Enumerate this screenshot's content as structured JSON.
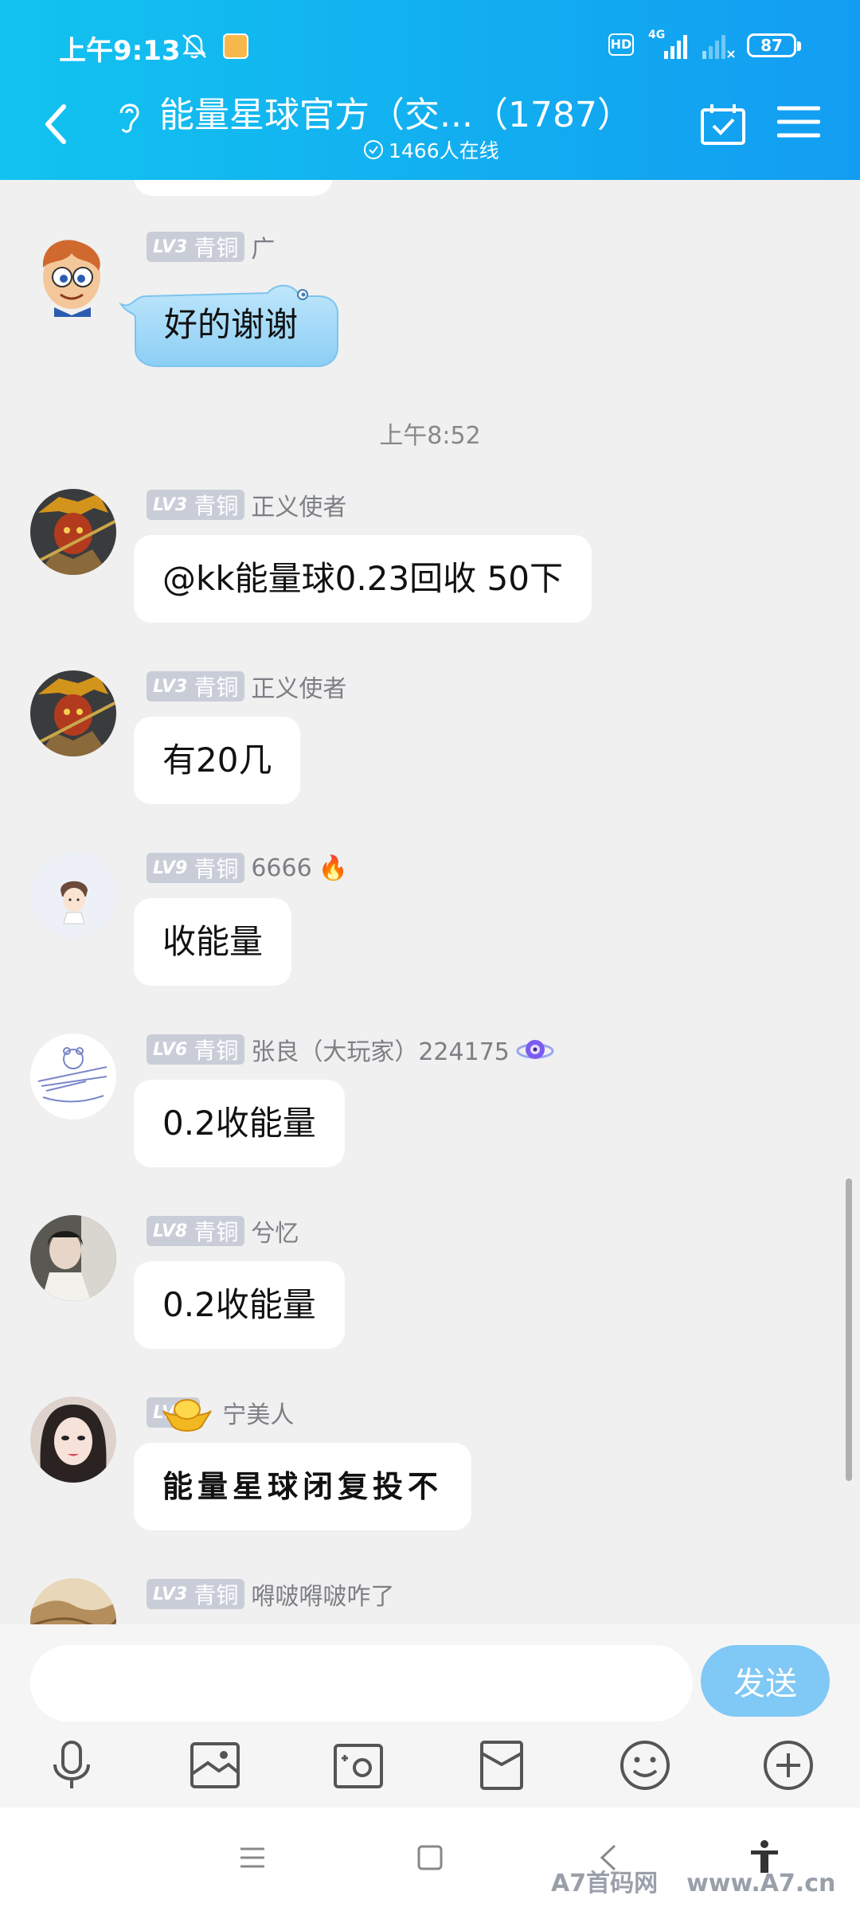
{
  "status_bar": {
    "time": "上午9:13",
    "network_type": "HD",
    "network_gen": "4G",
    "battery": "87"
  },
  "header": {
    "title": "能量星球官方（交...（1787）",
    "online": "1466人在线"
  },
  "messages": [
    {
      "level": "LV3",
      "rank": "青铜",
      "nick": "广",
      "text": "好的谢谢",
      "style": "cloud"
    },
    {
      "timestamp": "上午8:52"
    },
    {
      "level": "LV3",
      "rank": "青铜",
      "nick": "正义使者",
      "text": "@kk能量球0.23回收 50下"
    },
    {
      "level": "LV3",
      "rank": "青铜",
      "nick": "正义使者",
      "text": "有20几"
    },
    {
      "level": "LV9",
      "rank": "青铜",
      "nick": "6666",
      "badge": "🔥",
      "text": "收能量"
    },
    {
      "level": "LV6",
      "rank": "青铜",
      "nick": "张良（大玩家）224175",
      "badge": "planet",
      "text": "0.2收能量"
    },
    {
      "level": "LV8",
      "rank": "青铜",
      "nick": "兮忆",
      "text": "0.2收能量"
    },
    {
      "level": "LV3",
      "rank": "",
      "nick": "宁美人",
      "badge": "gold-ingot",
      "text": "能量星球闭复投不"
    },
    {
      "level": "LV3",
      "rank": "青铜",
      "nick": "嘚啵嘚啵咋了"
    }
  ],
  "input": {
    "placeholder": "",
    "send_label": "发送"
  },
  "toolbar": [
    "microphone-icon",
    "image-icon",
    "camera-icon",
    "red-packet-icon",
    "emoji-icon",
    "plus-icon"
  ],
  "watermark": {
    "left": "A7首码网",
    "right": "www.A7.cn"
  },
  "colors": {
    "header_gradient_start": "#12c3f0",
    "header_gradient_end": "#139df2",
    "send_button": "#80c8f5",
    "level_badge": "#c9cdd8"
  }
}
